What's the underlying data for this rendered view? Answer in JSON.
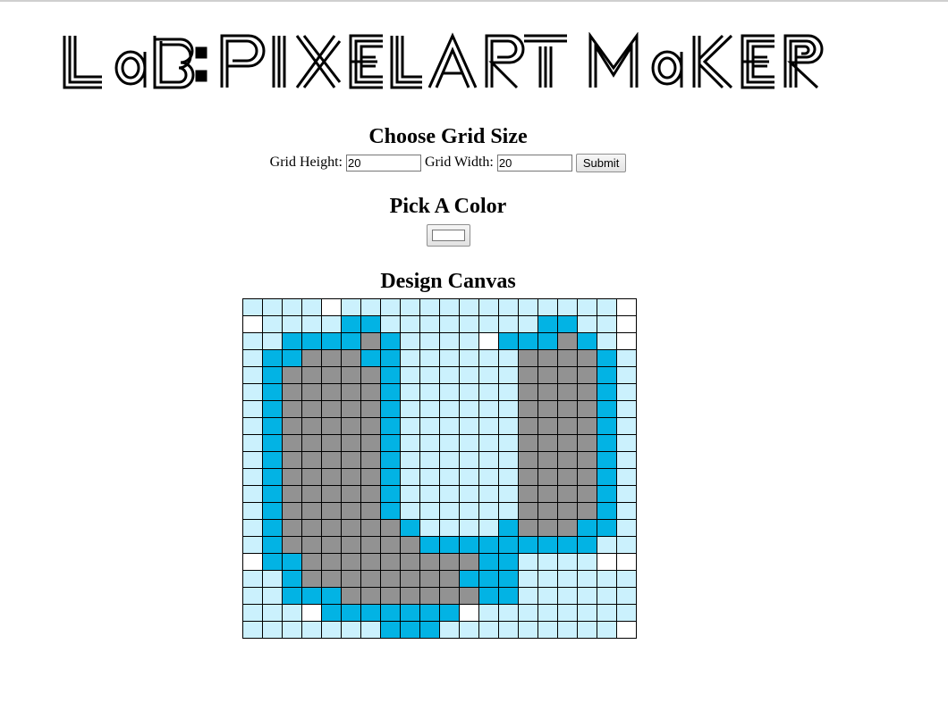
{
  "page": {
    "title": "Lab: Pixel Art Maker"
  },
  "grid_size": {
    "heading": "Choose Grid Size",
    "height_label": "Grid Height:",
    "height_value": "20",
    "width_label": "Grid Width:",
    "width_value": "20",
    "submit_label": "Submit"
  },
  "color_picker": {
    "heading": "Pick A Color",
    "value": "#ffffff"
  },
  "canvas": {
    "heading": "Design Canvas",
    "rows": 20,
    "cols": 20,
    "palette": {
      "w": "#ffffff",
      "l": "#cbf1fd",
      "b": "#02b3e4",
      "g": "#929292"
    },
    "pixels": [
      "llllwllllllllllllllw",
      "wllllbbllllllllbbllw",
      "llbbbbgbllllwbbbgblw",
      "lbbgggbbllllllggggbl",
      "lbgggggbllllllggggbl",
      "lbgggggbllllllggggbl",
      "lbgggggbllllllggggbl",
      "lbgggggbllllllggggbl",
      "lbgggggbllllllggggbl",
      "lbgggggbllllllggggbl",
      "lbgggggbllllllggggbl",
      "lbgggggbllllllggggbl",
      "lbgggggbllllllggggbl",
      "lbggggggbllllbgggbbl",
      "lbgggggggbbbbbbbbbll",
      "wbbgggggggggbbllllww",
      "llbggggggggbbbllllll",
      "llbbbgggggggbbllllll",
      "lllwbbbbbbbwllllllll",
      "lllllllbbblllllllllw"
    ]
  }
}
